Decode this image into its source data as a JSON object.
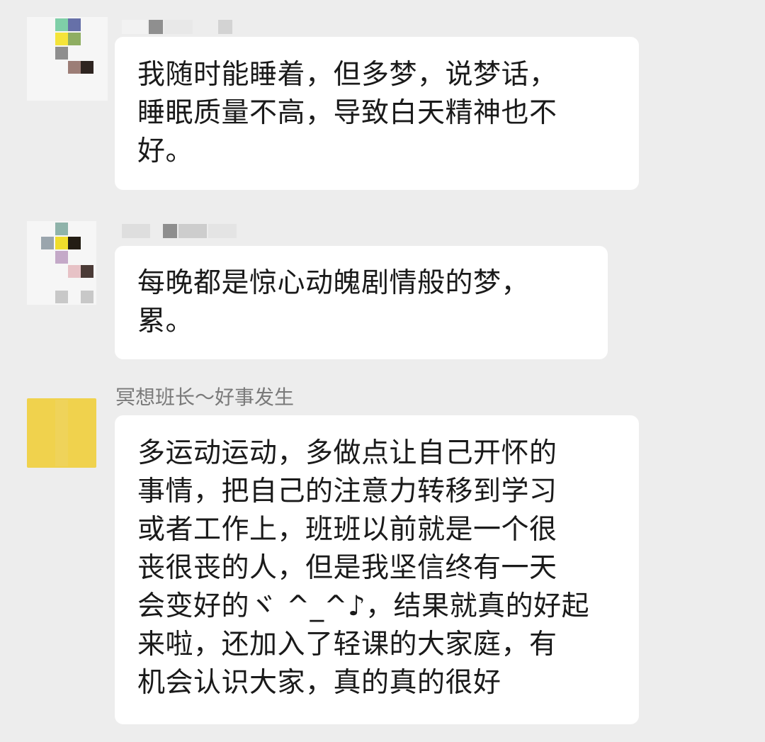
{
  "messages": [
    {
      "sender": "",
      "lines": [
        "我随时能睡着，但多梦，说梦话，",
        "睡眠质量不高，导致白天精神也不",
        "好。"
      ]
    },
    {
      "sender": "",
      "lines": [
        "每晚都是惊心动魄剧情般的梦，",
        "累。"
      ]
    },
    {
      "sender": "冥想班长～好事发生",
      "lines": [
        "多运动运动，多做点让自己开怀的",
        "事情，把自己的注意力转移到学习",
        "或者工作上，班班以前就是一个很",
        "丧很丧的人，但是我坚信终有一天",
        "会变好的ヾ ^_^♪，结果就真的好起",
        "来啦，还加入了轻课的大家庭，有",
        "机会认识大家，真的真的很好"
      ]
    }
  ]
}
